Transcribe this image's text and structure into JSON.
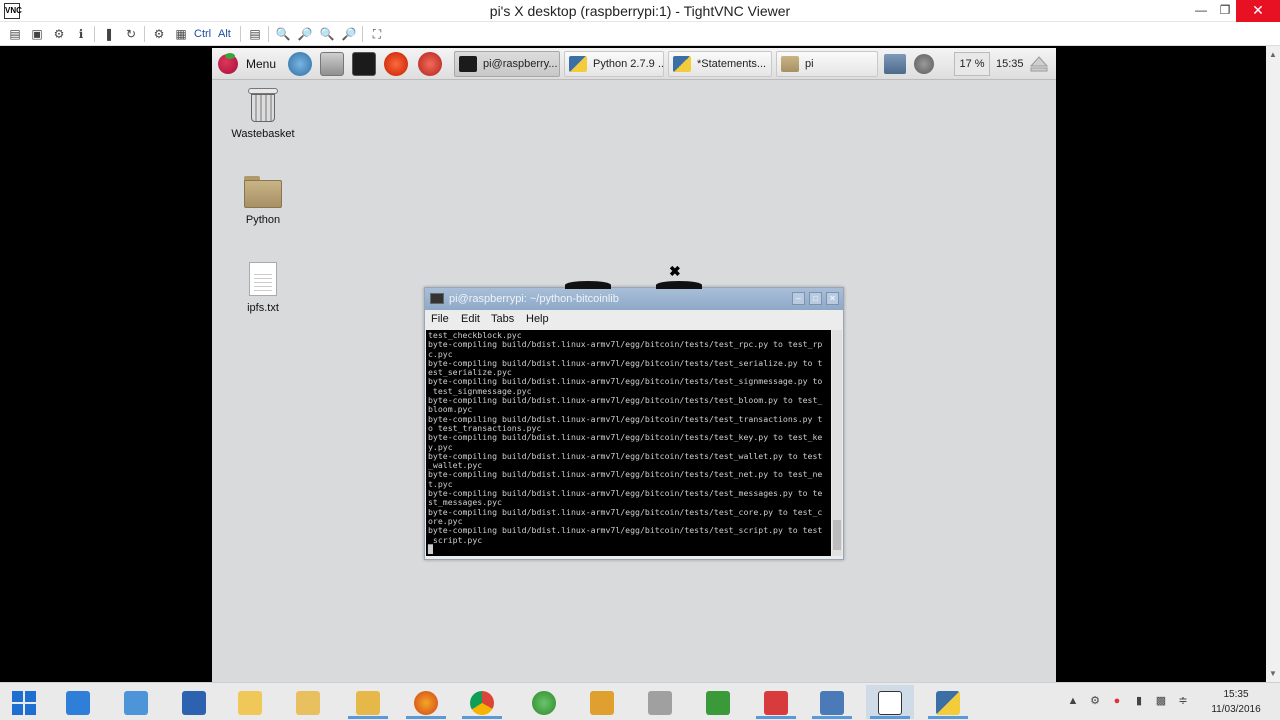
{
  "viewer": {
    "title": "pi's X desktop (raspberrypi:1) - TightVNC Viewer",
    "toolbar_ctrl": "Ctrl",
    "toolbar_alt": "Alt"
  },
  "pi_panel": {
    "menu_label": "Menu",
    "tasks": [
      {
        "label": "pi@raspberry...",
        "icon": "terminal-icon"
      },
      {
        "label": "Python 2.7.9 ...",
        "icon": "python-icon"
      },
      {
        "label": "*Statements...",
        "icon": "python-icon"
      },
      {
        "label": "pi",
        "icon": "folder-icon"
      }
    ],
    "cpu": "17 %",
    "clock": "15:35"
  },
  "desktop_icons": [
    {
      "label": "Wastebasket",
      "icon": "trash-icon"
    },
    {
      "label": "Python",
      "icon": "folder-icon"
    },
    {
      "label": "ipfs.txt",
      "icon": "text-file-icon"
    }
  ],
  "terminal": {
    "title": "pi@raspberrypi: ~/python-bitcoinlib",
    "menu": [
      "File",
      "Edit",
      "Tabs",
      "Help"
    ],
    "output": "test_checkblock.pyc\nbyte-compiling build/bdist.linux-armv7l/egg/bitcoin/tests/test_rpc.py to test_rp\nc.pyc\nbyte-compiling build/bdist.linux-armv7l/egg/bitcoin/tests/test_serialize.py to t\nest_serialize.pyc\nbyte-compiling build/bdist.linux-armv7l/egg/bitcoin/tests/test_signmessage.py to\n test_signmessage.pyc\nbyte-compiling build/bdist.linux-armv7l/egg/bitcoin/tests/test_bloom.py to test_\nbloom.pyc\nbyte-compiling build/bdist.linux-armv7l/egg/bitcoin/tests/test_transactions.py t\no test_transactions.pyc\nbyte-compiling build/bdist.linux-armv7l/egg/bitcoin/tests/test_key.py to test_ke\ny.pyc\nbyte-compiling build/bdist.linux-armv7l/egg/bitcoin/tests/test_wallet.py to test\n_wallet.pyc\nbyte-compiling build/bdist.linux-armv7l/egg/bitcoin/tests/test_net.py to test_ne\nt.pyc\nbyte-compiling build/bdist.linux-armv7l/egg/bitcoin/tests/test_messages.py to te\nst_messages.pyc\nbyte-compiling build/bdist.linux-armv7l/egg/bitcoin/tests/test_core.py to test_c\nore.pyc\nbyte-compiling build/bdist.linux-armv7l/egg/bitcoin/tests/test_script.py to test\n_script.pyc\n█"
  },
  "windows_taskbar": {
    "time": "15:35",
    "date": "11/03/2016",
    "apps": [
      "home-icon",
      "network-icon",
      "document-icon",
      "file-manager-icon",
      "file-manager-icon",
      "folder-icon",
      "firefox-icon",
      "chrome-icon",
      "globe-icon",
      "puzzle-icon",
      "tools-icon",
      "chart-icon",
      "skype-icon",
      "network-tool-icon",
      "vnc-icon",
      "python-icon"
    ],
    "colors": {
      "accent": "#1f6fd1",
      "running": "#5a9ad8"
    }
  }
}
